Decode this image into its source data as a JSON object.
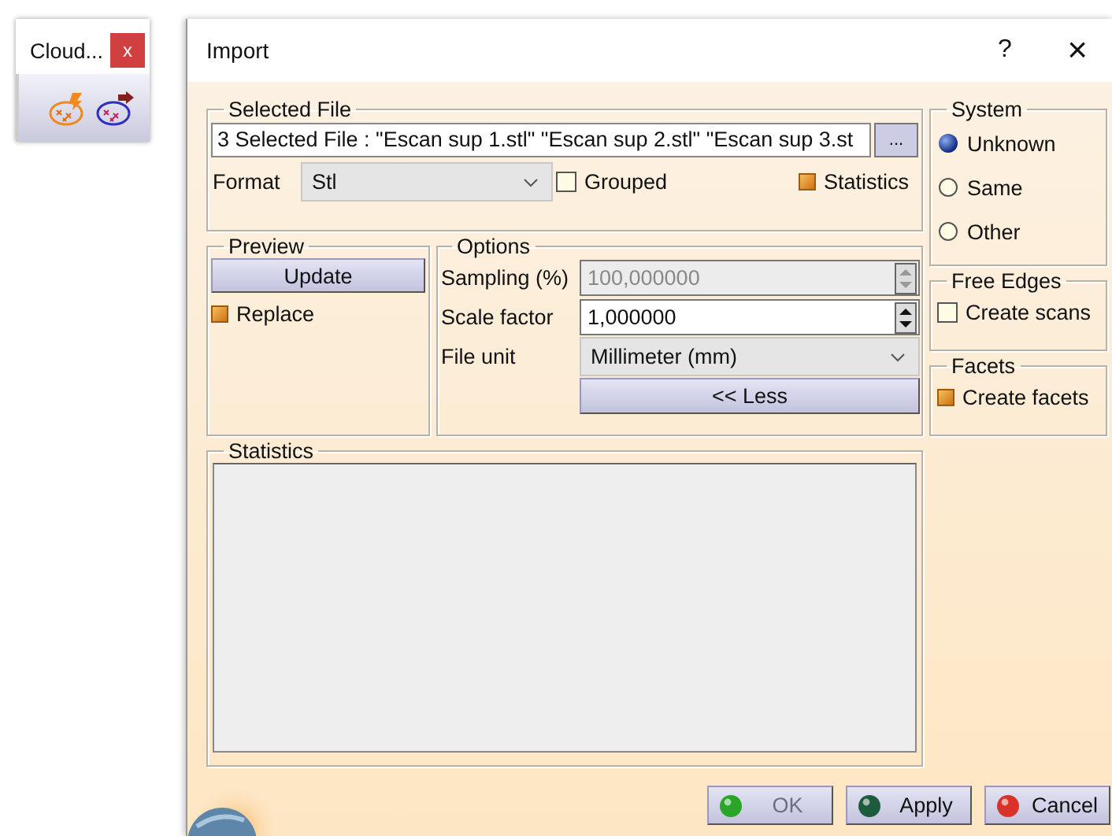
{
  "toolbar": {
    "title": "Cloud...",
    "close": "x"
  },
  "dialog": {
    "title": "Import",
    "help": "?",
    "close": "×"
  },
  "selected_file": {
    "legend": "Selected File",
    "value": "3 Selected File : \"Escan sup 1.stl\" \"Escan sup 2.stl\" \"Escan sup 3.st",
    "browse": "...",
    "format_label": "Format",
    "format_value": "Stl",
    "grouped": {
      "label": "Grouped",
      "checked": false
    },
    "statistics": {
      "label": "Statistics",
      "checked": true
    }
  },
  "preview": {
    "legend": "Preview",
    "update": "Update",
    "replace": {
      "label": "Replace",
      "checked": true
    }
  },
  "options": {
    "legend": "Options",
    "sampling": {
      "label": "Sampling (%)",
      "value": "100,000000",
      "disabled": true
    },
    "scale_factor": {
      "label": "Scale factor",
      "value": "1,000000",
      "disabled": false
    },
    "file_unit": {
      "label": "File unit",
      "value": "Millimeter (mm)"
    },
    "less": "<< Less"
  },
  "statistics_panel": {
    "legend": "Statistics"
  },
  "system": {
    "legend": "System",
    "options": [
      {
        "label": "Unknown",
        "selected": true
      },
      {
        "label": "Same",
        "selected": false
      },
      {
        "label": "Other",
        "selected": false
      }
    ]
  },
  "free_edges": {
    "legend": "Free Edges",
    "create_scans": {
      "label": "Create scans",
      "checked": false
    }
  },
  "facets": {
    "legend": "Facets",
    "create_facets": {
      "label": "Create facets",
      "checked": true
    }
  },
  "buttons": [
    {
      "kind": "ok",
      "label": "OK",
      "disabled": true
    },
    {
      "kind": "apply",
      "label": "Apply",
      "disabled": false
    },
    {
      "kind": "cancel",
      "label": "Cancel",
      "disabled": false
    }
  ]
}
